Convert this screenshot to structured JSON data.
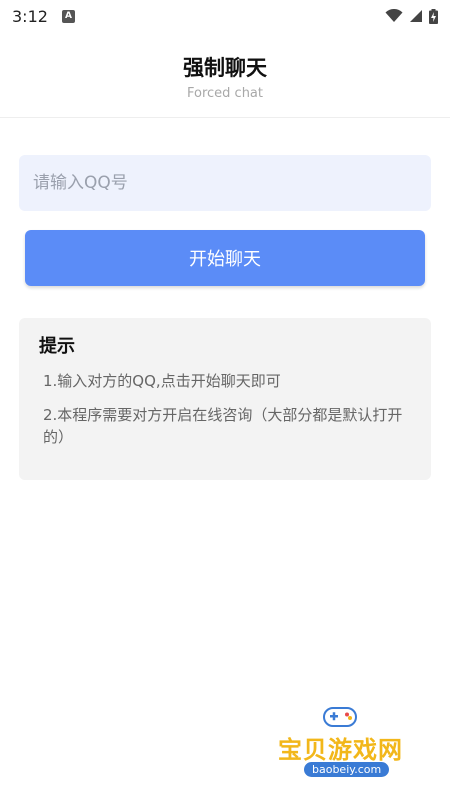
{
  "status_bar": {
    "time": "3:12",
    "notification_icon": "a-icon",
    "wifi_icon": "wifi-icon",
    "signal_icon": "signal-icon",
    "battery_icon": "battery-charging-icon"
  },
  "header": {
    "title": "强制聊天",
    "subtitle": "Forced chat"
  },
  "qq_input": {
    "value": "",
    "placeholder": "请输入QQ号"
  },
  "start_button": {
    "label": "开始聊天"
  },
  "tips": {
    "title": "提示",
    "items": [
      "1.输入对方的QQ,点击开始聊天即可",
      "2.本程序需要对方开启在线咨询（大部分都是默认打开的）"
    ]
  },
  "watermark": {
    "text": "宝贝游戏网",
    "domain": "baobeiy.com"
  },
  "colors": {
    "primary": "#5b8cf7",
    "input_bg": "#eef2fd",
    "card_bg": "#f3f3f3",
    "watermark": "#f2b71a"
  }
}
